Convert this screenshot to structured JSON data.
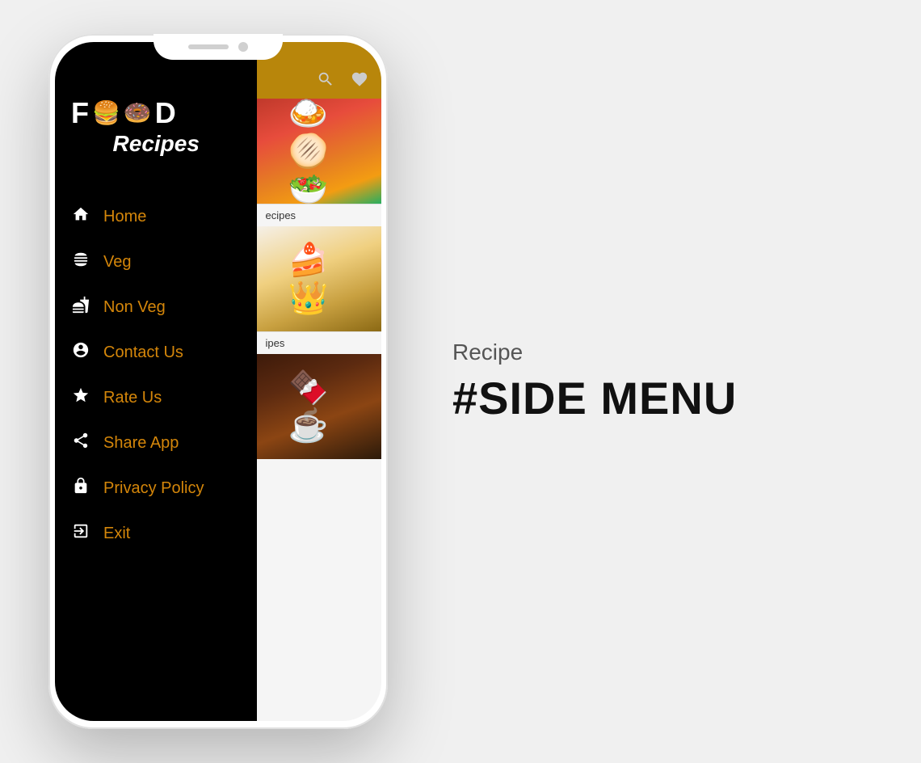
{
  "page": {
    "background": "#f0f0f0"
  },
  "phone": {
    "logo": {
      "text_before": "F",
      "emoji1": "🍔",
      "emoji2": "🍩",
      "text_after": "D",
      "subtitle": "Recipes"
    },
    "menu": {
      "items": [
        {
          "id": "home",
          "icon": "🏠",
          "label": "Home"
        },
        {
          "id": "veg",
          "icon": "🍔",
          "label": "Veg"
        },
        {
          "id": "non-veg",
          "icon": "🍖",
          "label": "Non Veg"
        },
        {
          "id": "contact",
          "icon": "👤",
          "label": "Contact Us"
        },
        {
          "id": "rate",
          "icon": "⭐",
          "label": "Rate Us"
        },
        {
          "id": "share",
          "icon": "↗",
          "label": "Share App"
        },
        {
          "id": "privacy",
          "icon": "🔒",
          "label": "Privacy Policy"
        },
        {
          "id": "exit",
          "icon": "🚪",
          "label": "Exit"
        }
      ]
    },
    "header_icons": {
      "search": "🔍",
      "heart": "♥"
    },
    "sections": [
      {
        "label": "ecipes"
      },
      {
        "label": "ipes"
      }
    ]
  },
  "right": {
    "tag": "Recipe",
    "title": "#SIDE MENU"
  }
}
